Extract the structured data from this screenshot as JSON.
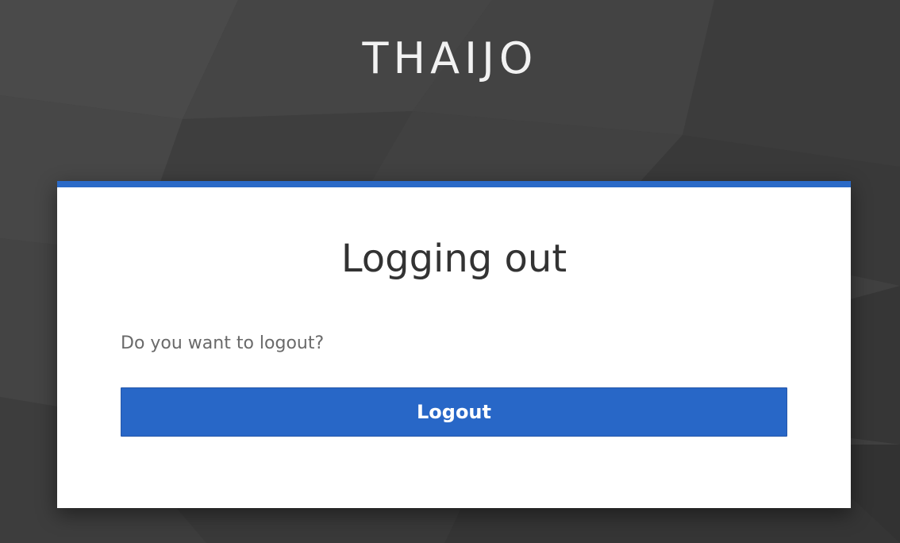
{
  "header": {
    "brand": "THAIJO"
  },
  "logout_card": {
    "title": "Logging out",
    "message": "Do you want to logout?",
    "logout_label": "Logout"
  },
  "colors": {
    "accent": "#2867c7",
    "background": "#3f3f3f",
    "card": "#ffffff"
  }
}
